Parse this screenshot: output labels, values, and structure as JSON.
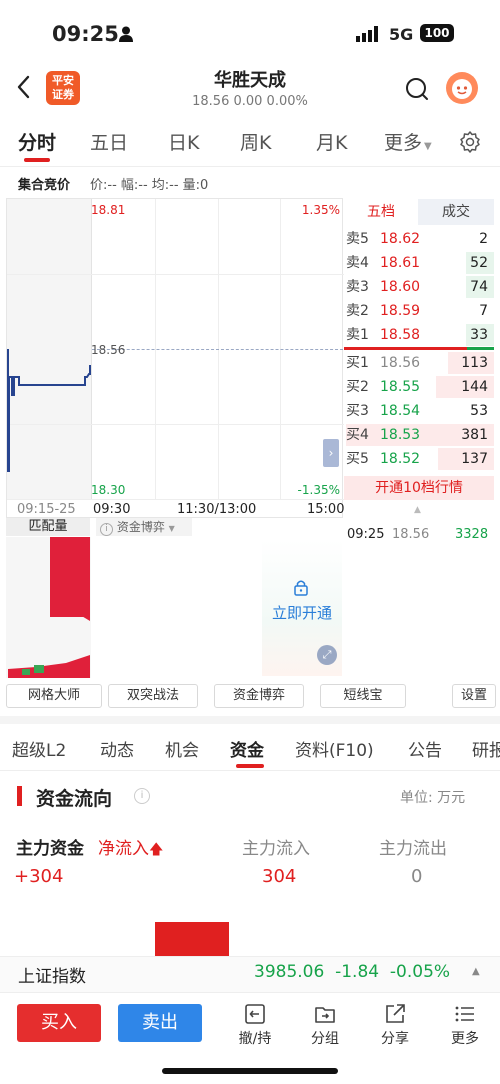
{
  "status_bar": {
    "time": "09:25",
    "network": "5G",
    "battery": "100"
  },
  "header": {
    "broker_logo_line1": "平安",
    "broker_logo_line2": "证券",
    "stock_name": "华胜天成",
    "quote": "18.56 0.00 0.00%"
  },
  "period_tabs": [
    "分时",
    "五日",
    "日K",
    "周K",
    "月K",
    "更多"
  ],
  "auction": {
    "label": "集合竞价",
    "stats": "价:-- 幅:-- 均:-- 量:0",
    "volume": "0"
  },
  "chart": {
    "price_high": "18.81",
    "price_mid": "18.56",
    "price_low": "18.30",
    "pct_high": "1.35%",
    "pct_low": "-1.35%",
    "time_labels": [
      "09:15-25",
      "09:30",
      "11:30/13:00",
      "15:00"
    ]
  },
  "order_book": {
    "tab_five_level": "五档",
    "tab_trades": "成交",
    "asks": [
      {
        "label": "卖5",
        "price": "18.62",
        "volume": "2"
      },
      {
        "label": "卖4",
        "price": "18.61",
        "volume": "52"
      },
      {
        "label": "卖3",
        "price": "18.60",
        "volume": "74"
      },
      {
        "label": "卖2",
        "price": "18.59",
        "volume": "7"
      },
      {
        "label": "卖1",
        "price": "18.58",
        "volume": "33"
      }
    ],
    "bids": [
      {
        "label": "买1",
        "price": "18.56",
        "volume": "113"
      },
      {
        "label": "买2",
        "price": "18.55",
        "volume": "144"
      },
      {
        "label": "买3",
        "price": "18.54",
        "volume": "53"
      },
      {
        "label": "买4",
        "price": "18.53",
        "volume": "381"
      },
      {
        "label": "买5",
        "price": "18.52",
        "volume": "137"
      }
    ],
    "open10_label": "开通10档行情",
    "trade": {
      "time": "09:25",
      "price": "18.56",
      "volume": "3328"
    }
  },
  "lower_chart": {
    "match_tab": "匹配量",
    "capital_game_tab": "资金博弈",
    "unlock_label": "立即开通"
  },
  "tools": [
    "网格大师",
    "双突战法",
    "资金博弈",
    "短线宝",
    "设置"
  ],
  "info_tabs": [
    "超级L2",
    "动态",
    "机会",
    "资金",
    "资料(F10)",
    "公告",
    "研报"
  ],
  "capital_flow": {
    "title": "资金流向",
    "unit": "单位: 万元",
    "main_fund_label": "主力资金",
    "net_inflow_label": "净流入",
    "inflow_label": "主力流入",
    "outflow_label": "主力流出",
    "main_fund_value": "+304",
    "inflow_value": "304",
    "outflow_value": "0"
  },
  "index_bar": {
    "name": "上证指数",
    "values": "3985.06  -1.84  -0.05%"
  },
  "toolbar": {
    "buy": "买入",
    "sell": "卖出",
    "items": [
      "撤/持",
      "分组",
      "分享",
      "更多"
    ]
  },
  "colors": {
    "up": "#e02020",
    "down": "#17a34a",
    "accent_blue": "#2f86e8"
  }
}
